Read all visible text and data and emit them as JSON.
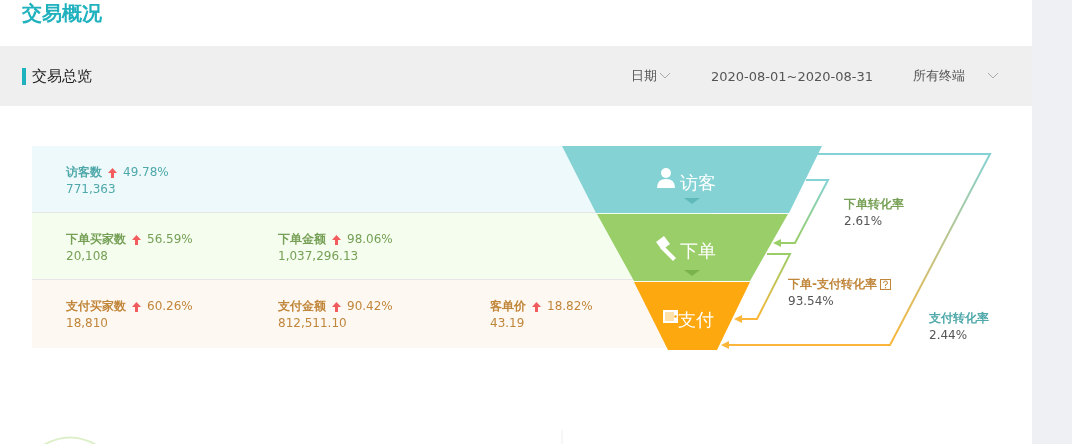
{
  "page_title": "交易概况",
  "section": {
    "title": "交易总览",
    "filters": [
      {
        "label": "日期",
        "kind": "dropdown"
      },
      {
        "label": "2020-08-01~2020-08-31",
        "kind": "text"
      },
      {
        "label": "所有终端",
        "kind": "dropdown"
      }
    ]
  },
  "funnel": {
    "stages": [
      {
        "label": "访客",
        "kind": "visitor",
        "metrics": [
          {
            "name": "访客数",
            "rising": true,
            "change": "49.78%",
            "value": "771,363"
          }
        ]
      },
      {
        "label": "下单",
        "kind": "order",
        "metrics": [
          {
            "name": "下单买家数",
            "rising": true,
            "change": "56.59%",
            "value": "20,108"
          },
          {
            "name": "下单金额",
            "rising": true,
            "change": "98.06%",
            "value": "1,037,296.13"
          }
        ]
      },
      {
        "label": "支付",
        "kind": "pay",
        "metrics": [
          {
            "name": "支付买家数",
            "rising": true,
            "change": "60.26%",
            "value": "18,810"
          },
          {
            "name": "支付金额",
            "rising": true,
            "change": "90.42%",
            "value": "812,511.10"
          },
          {
            "name": "客单价",
            "rising": true,
            "change": "18.82%",
            "value": "43.19"
          }
        ]
      }
    ],
    "rates": [
      {
        "kind": "order",
        "label": "下单转化率",
        "value": "2.61%",
        "help": false
      },
      {
        "kind": "pay",
        "label": "下单-支付转化率",
        "value": "93.54%",
        "help": true
      },
      {
        "kind": "overall",
        "label": "支付转化率",
        "value": "2.44%",
        "help": false
      }
    ]
  }
}
